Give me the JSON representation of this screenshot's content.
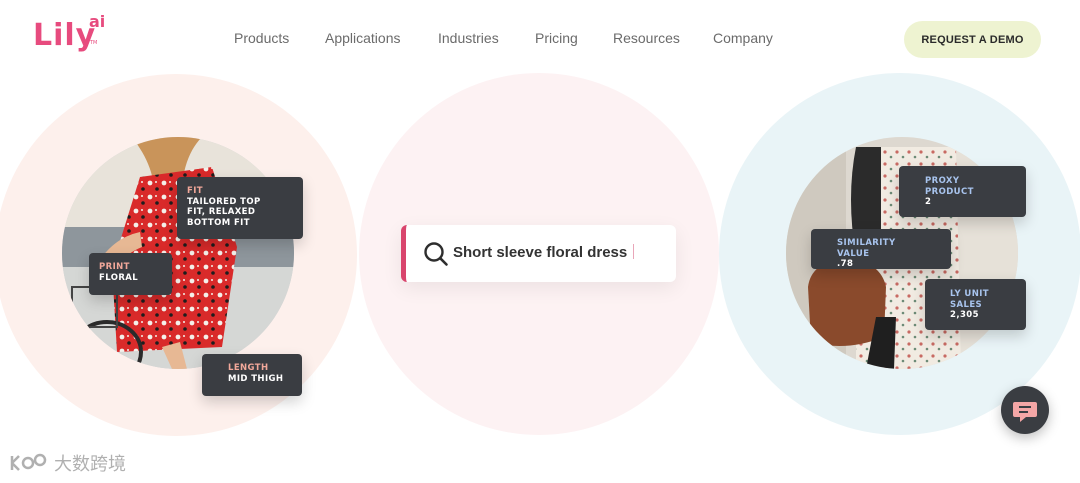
{
  "brand": {
    "logo_text": "Lily",
    "logo_sup": "ai",
    "logo_tm": "TM",
    "color": "#e74b7e"
  },
  "nav": {
    "items": [
      {
        "label": "Products"
      },
      {
        "label": "Applications"
      },
      {
        "label": "Industries"
      },
      {
        "label": "Pricing"
      },
      {
        "label": "Resources"
      },
      {
        "label": "Company"
      }
    ],
    "cta_label": "REQUEST A DEMO"
  },
  "left_tags": {
    "fit": {
      "key": "FIT",
      "value": "TAILORED TOP\nFIT, RELAXED\nBOTTOM FIT"
    },
    "print": {
      "key": "PRINT",
      "value": "FLORAL"
    },
    "length": {
      "key": "LENGTH",
      "value": "MID THIGH"
    }
  },
  "search": {
    "value": "Short sleeve floral dress",
    "accent": "#d9456d"
  },
  "right_tags": {
    "proxy": {
      "key": "PROXY\nPRODUCT",
      "value": "2"
    },
    "similarity": {
      "key": "SIMILARITY VALUE",
      "value": ".78"
    },
    "sales": {
      "key": "LY UNIT\nSALES",
      "value": "2,305"
    }
  },
  "watermark": {
    "text": "大数跨境"
  },
  "colors": {
    "bg_left": "#fdf0ec",
    "bg_center": "#fdf2f3",
    "bg_right": "#e9f4f7",
    "tag_bg": "#3a3d42",
    "demo_bg": "#eef3d1"
  }
}
